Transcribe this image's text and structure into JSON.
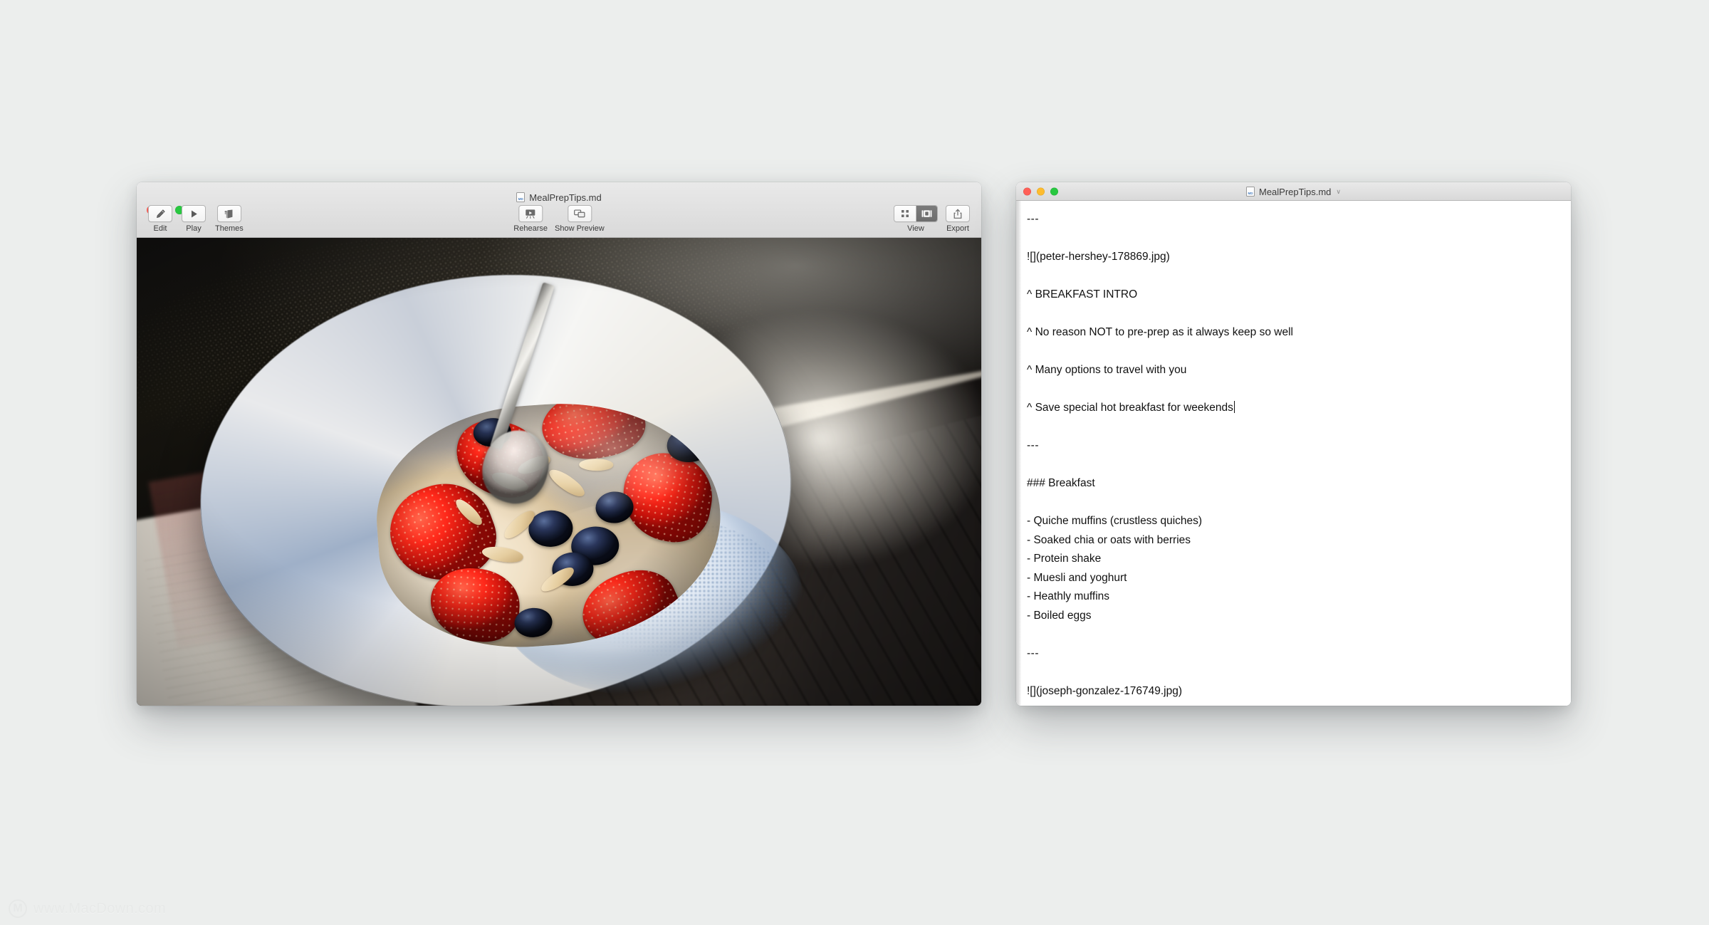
{
  "watermark": {
    "text": "www.MacDown.com",
    "logo_glyph": "M"
  },
  "left_window": {
    "title": "MealPrepTips.md",
    "traffic_lights": [
      "close",
      "minimize",
      "zoom"
    ],
    "toolbar": {
      "left_items": [
        {
          "label": "Edit",
          "icon": "pencil-icon"
        },
        {
          "label": "Play",
          "icon": "play-icon"
        },
        {
          "label": "Themes",
          "icon": "themes-icon"
        }
      ],
      "center_items": [
        {
          "label": "Rehearse",
          "icon": "rehearse-icon"
        },
        {
          "label": "Show Preview",
          "icon": "preview-icon"
        }
      ],
      "right_items": [
        {
          "label": "View",
          "icon": "view-segmented-icon"
        },
        {
          "label": "Export",
          "icon": "share-icon"
        }
      ],
      "view_segments": [
        {
          "icon": "grid-icon",
          "selected": false
        },
        {
          "icon": "slide-layout-icon",
          "selected": true
        }
      ]
    },
    "slide": {
      "image_description": "Breakfast bowl of yoghurt with strawberries, blueberries and sliced almonds in a dark speckled blue-and-white ceramic bowl, spoon resting inside, on a notebook beside a sunlit window"
    }
  },
  "right_window": {
    "title": "MealPrepTips.md",
    "title_chevron": "∨",
    "traffic_lights": [
      "close",
      "minimize",
      "zoom"
    ],
    "document": {
      "lines": [
        "---",
        "",
        "![](peter-hershey-178869.jpg)",
        "",
        "^ BREAKFAST INTRO",
        "",
        "^ No reason NOT to pre-prep as it always keep so well",
        "",
        "^ Many options to travel with you",
        "",
        "^ Save special hot breakfast for weekends",
        "",
        "---",
        "",
        "### Breakfast",
        "",
        "- Quiche muffins (crustless quiches)",
        "- Soaked chia or oats with berries",
        "- Protein shake",
        "- Muesli and yoghurt",
        "- Heathly muffins",
        "- Boiled eggs",
        "",
        "---",
        "",
        "![](joseph-gonzalez-176749.jpg)"
      ],
      "caret_line_index": 10
    }
  },
  "colors": {
    "desktop": "#eceeed",
    "titlebar_top": "#e9e9e9",
    "titlebar_bottom": "#d9d9d9",
    "editor_background": "#ffffff",
    "text": "#111111",
    "traffic_red": "#ff5f57",
    "traffic_yellow": "#febc2e",
    "traffic_green": "#28c840",
    "segment_active": "#6d6d6d"
  }
}
